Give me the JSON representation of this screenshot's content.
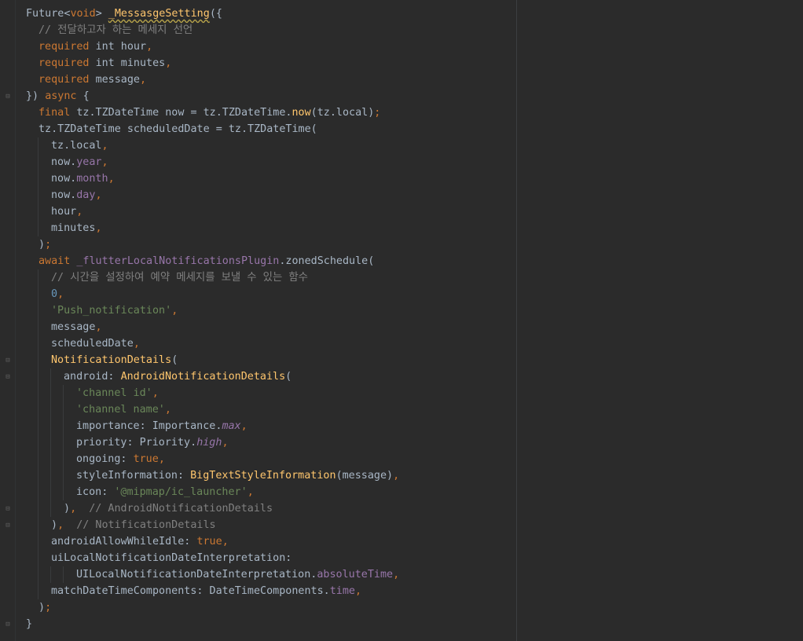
{
  "editor": {
    "lines": [
      {
        "indent": 0,
        "tokens": [
          {
            "t": "Future<",
            "c": "plain"
          },
          {
            "t": "void",
            "c": "kw"
          },
          {
            "t": "> ",
            "c": "plain"
          },
          {
            "t": "_MessasgeSetting",
            "c": "fn-under"
          },
          {
            "t": "({",
            "c": "plain"
          }
        ]
      },
      {
        "indent": 1,
        "tokens": [
          {
            "t": "// 전달하고자 하는 메세지 선언",
            "c": "cm"
          }
        ]
      },
      {
        "indent": 1,
        "tokens": [
          {
            "t": "required ",
            "c": "kw"
          },
          {
            "t": "int hour",
            "c": "plain"
          },
          {
            "t": ",",
            "c": "kw"
          }
        ]
      },
      {
        "indent": 1,
        "tokens": [
          {
            "t": "required ",
            "c": "kw"
          },
          {
            "t": "int minutes",
            "c": "plain"
          },
          {
            "t": ",",
            "c": "kw"
          }
        ]
      },
      {
        "indent": 1,
        "tokens": [
          {
            "t": "required ",
            "c": "kw"
          },
          {
            "t": "message",
            "c": "plain"
          },
          {
            "t": ",",
            "c": "kw"
          }
        ]
      },
      {
        "indent": 0,
        "fold": true,
        "tokens": [
          {
            "t": "}) ",
            "c": "plain"
          },
          {
            "t": "async ",
            "c": "kw"
          },
          {
            "t": "{",
            "c": "plain"
          }
        ]
      },
      {
        "indent": 1,
        "tokens": [
          {
            "t": "final ",
            "c": "kw"
          },
          {
            "t": "tz.TZDateTime now = tz.TZDateTime.",
            "c": "plain"
          },
          {
            "t": "now",
            "c": "fn"
          },
          {
            "t": "(tz.local)",
            "c": "plain"
          },
          {
            "t": ";",
            "c": "kw"
          }
        ]
      },
      {
        "indent": 1,
        "tokens": [
          {
            "t": "tz.TZDateTime scheduledDate = tz.TZDateTime(",
            "c": "plain"
          }
        ]
      },
      {
        "indent": 2,
        "tokens": [
          {
            "t": "tz.local",
            "c": "plain"
          },
          {
            "t": ",",
            "c": "kw"
          }
        ]
      },
      {
        "indent": 2,
        "tokens": [
          {
            "t": "now.",
            "c": "plain"
          },
          {
            "t": "year",
            "c": "prop"
          },
          {
            "t": ",",
            "c": "kw"
          }
        ]
      },
      {
        "indent": 2,
        "tokens": [
          {
            "t": "now.",
            "c": "plain"
          },
          {
            "t": "month",
            "c": "prop"
          },
          {
            "t": ",",
            "c": "kw"
          }
        ]
      },
      {
        "indent": 2,
        "tokens": [
          {
            "t": "now.",
            "c": "plain"
          },
          {
            "t": "day",
            "c": "prop"
          },
          {
            "t": ",",
            "c": "kw"
          }
        ]
      },
      {
        "indent": 2,
        "tokens": [
          {
            "t": "hour",
            "c": "plain"
          },
          {
            "t": ",",
            "c": "kw"
          }
        ]
      },
      {
        "indent": 2,
        "tokens": [
          {
            "t": "minutes",
            "c": "plain"
          },
          {
            "t": ",",
            "c": "kw"
          }
        ]
      },
      {
        "indent": 1,
        "tokens": [
          {
            "t": ")",
            "c": "plain"
          },
          {
            "t": ";",
            "c": "kw"
          }
        ]
      },
      {
        "indent": 1,
        "tokens": [
          {
            "t": "await ",
            "c": "kw"
          },
          {
            "t": "_flutterLocalNotificationsPlugin",
            "c": "prop"
          },
          {
            "t": ".zonedSchedule(",
            "c": "plain"
          }
        ]
      },
      {
        "indent": 2,
        "tokens": [
          {
            "t": "// 시간을 설정하여 예약 메세지를 보낼 수 있는 함수",
            "c": "cm"
          }
        ]
      },
      {
        "indent": 2,
        "tokens": [
          {
            "t": "0",
            "c": "num"
          },
          {
            "t": ",",
            "c": "kw"
          }
        ]
      },
      {
        "indent": 2,
        "tokens": [
          {
            "t": "'Push_notification'",
            "c": "str"
          },
          {
            "t": ",",
            "c": "kw"
          }
        ]
      },
      {
        "indent": 2,
        "tokens": [
          {
            "t": "message",
            "c": "plain"
          },
          {
            "t": ",",
            "c": "kw"
          }
        ]
      },
      {
        "indent": 2,
        "tokens": [
          {
            "t": "scheduledDate",
            "c": "plain"
          },
          {
            "t": ",",
            "c": "kw"
          }
        ]
      },
      {
        "indent": 2,
        "fold": true,
        "tokens": [
          {
            "t": "NotificationDetails",
            "c": "fn"
          },
          {
            "t": "(",
            "c": "plain"
          }
        ]
      },
      {
        "indent": 3,
        "fold": true,
        "tokens": [
          {
            "t": "android: ",
            "c": "plain"
          },
          {
            "t": "AndroidNotificationDetails",
            "c": "fn"
          },
          {
            "t": "(",
            "c": "plain"
          }
        ]
      },
      {
        "indent": 4,
        "tokens": [
          {
            "t": "'channel id'",
            "c": "str"
          },
          {
            "t": ",",
            "c": "kw"
          }
        ]
      },
      {
        "indent": 4,
        "tokens": [
          {
            "t": "'channel name'",
            "c": "str"
          },
          {
            "t": ",",
            "c": "kw"
          }
        ]
      },
      {
        "indent": 4,
        "tokens": [
          {
            "t": "importance: Importance.",
            "c": "plain"
          },
          {
            "t": "max",
            "c": "prop-i"
          },
          {
            "t": ",",
            "c": "kw"
          }
        ]
      },
      {
        "indent": 4,
        "tokens": [
          {
            "t": "priority: Priority.",
            "c": "plain"
          },
          {
            "t": "high",
            "c": "prop-i"
          },
          {
            "t": ",",
            "c": "kw"
          }
        ]
      },
      {
        "indent": 4,
        "tokens": [
          {
            "t": "ongoing: ",
            "c": "plain"
          },
          {
            "t": "true",
            "c": "kw"
          },
          {
            "t": ",",
            "c": "kw"
          }
        ]
      },
      {
        "indent": 4,
        "tokens": [
          {
            "t": "styleInformation: ",
            "c": "plain"
          },
          {
            "t": "BigTextStyleInformation",
            "c": "fn"
          },
          {
            "t": "(message)",
            "c": "plain"
          },
          {
            "t": ",",
            "c": "kw"
          }
        ]
      },
      {
        "indent": 4,
        "tokens": [
          {
            "t": "icon: ",
            "c": "plain"
          },
          {
            "t": "'@mipmap/ic_launcher'",
            "c": "str"
          },
          {
            "t": ",",
            "c": "kw"
          }
        ]
      },
      {
        "indent": 3,
        "fold": true,
        "tokens": [
          {
            "t": ")",
            "c": "plain"
          },
          {
            "t": ",",
            "c": "kw"
          },
          {
            "t": "  // AndroidNotificationDetails",
            "c": "cm"
          }
        ]
      },
      {
        "indent": 2,
        "fold": true,
        "tokens": [
          {
            "t": ")",
            "c": "plain"
          },
          {
            "t": ",",
            "c": "kw"
          },
          {
            "t": "  // NotificationDetails",
            "c": "cm"
          }
        ]
      },
      {
        "indent": 2,
        "tokens": [
          {
            "t": "androidAllowWhileIdle: ",
            "c": "plain"
          },
          {
            "t": "true",
            "c": "kw"
          },
          {
            "t": ",",
            "c": "kw"
          }
        ]
      },
      {
        "indent": 2,
        "tokens": [
          {
            "t": "uiLocalNotificationDateInterpretation:",
            "c": "plain"
          }
        ]
      },
      {
        "indent": 4,
        "tokens": [
          {
            "t": "UILocalNotificationDateInterpretation.",
            "c": "plain"
          },
          {
            "t": "absoluteTime",
            "c": "prop"
          },
          {
            "t": ",",
            "c": "kw"
          }
        ]
      },
      {
        "indent": 2,
        "tokens": [
          {
            "t": "matchDateTimeComponents: DateTimeComponents.",
            "c": "plain"
          },
          {
            "t": "time",
            "c": "prop"
          },
          {
            "t": ",",
            "c": "kw"
          }
        ]
      },
      {
        "indent": 1,
        "tokens": [
          {
            "t": ")",
            "c": "plain"
          },
          {
            "t": ";",
            "c": "kw"
          }
        ]
      },
      {
        "indent": 0,
        "fold": true,
        "tokens": [
          {
            "t": "}",
            "c": "plain"
          }
        ]
      }
    ]
  }
}
